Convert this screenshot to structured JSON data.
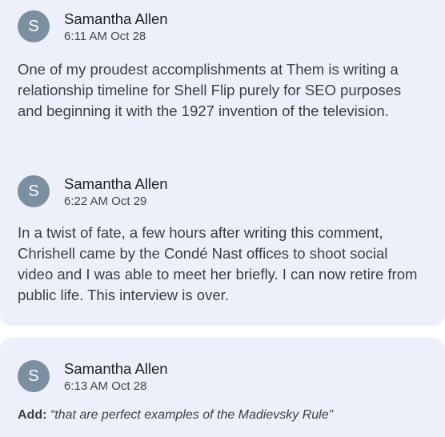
{
  "comments": [
    {
      "avatar_letter": "S",
      "author": "Samantha Allen",
      "timestamp": "6:11 AM Oct 28",
      "body": "One of my proudest accomplishments at Them is writing a relationship timeline for Shell Flip purely for SEO purposes and beginning it with the 1927 invention of the television."
    },
    {
      "avatar_letter": "S",
      "author": "Samantha Allen",
      "timestamp": "6:22 AM Oct 29",
      "body": "In a twist of fate, a few hours after writing this comment, Chrishell came by the Condé Nast offices to shoot social video and I was able to meet her briefly. I can now retire from public life. This interview is over."
    },
    {
      "avatar_letter": "S",
      "author": "Samantha Allen",
      "timestamp": "6:13 AM Oct 28",
      "edit_label": "Add:",
      "edit_text": "“that are perfect examples of the Madievsky Rule”"
    }
  ],
  "colors": {
    "card_background": "#edf0fa",
    "avatar_background": "#7c8fa0"
  }
}
